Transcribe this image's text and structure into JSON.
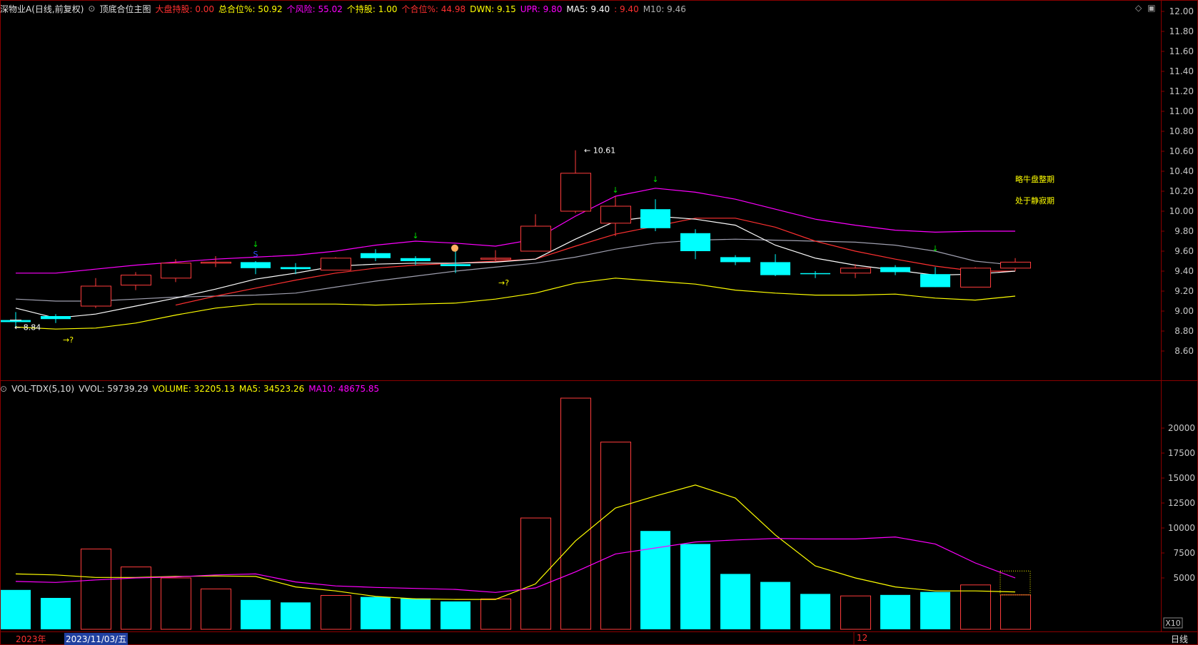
{
  "header": {
    "stock": "深物业A(日线,前复权)",
    "indicator": "顶底合位主图",
    "items": [
      {
        "label": "大盘持股: 0.00",
        "color": "#ff3030"
      },
      {
        "label": "总合位%: 50.92",
        "color": "#ffff00"
      },
      {
        "label": "个风险: 55.02",
        "color": "#ff00ff"
      },
      {
        "label": "个持股: 1.00",
        "color": "#ffff00"
      },
      {
        "label": "个合位%: 44.98",
        "color": "#ff3030"
      },
      {
        "label": "DWN: 9.15",
        "color": "#ffff00"
      },
      {
        "label": "UPR: 9.80",
        "color": "#ff00ff"
      },
      {
        "label": "MA5: 9.40",
        "color": "#ffffff"
      },
      {
        "label": ": 9.40",
        "color": "#ff3030"
      },
      {
        "label": "M10: 9.46",
        "color": "#b0b0b0"
      }
    ]
  },
  "vol_header": {
    "name": "VOL-TDX(5,10)",
    "vvol": "VVOL: 59739.29",
    "volume": "VOLUME: 32205.13",
    "ma5": "MA5: 34523.26",
    "ma10": "MA10: 48675.85"
  },
  "annotations": {
    "high": "10.61",
    "low": "8.84",
    "side1": "略牛盘整期",
    "side2": "处于静寂期",
    "q1": "→?",
    "q2": "→?",
    "s": "S"
  },
  "footer": {
    "year": "2023年",
    "date": "2023/11/03/五",
    "month": "12",
    "period": "日线",
    "x10": "X10"
  },
  "colors": {
    "up": "#ff3c3c",
    "down": "#00ffff",
    "ma_white": "#ffffff",
    "ma_red": "#ff3030",
    "ma_gray": "#a0a0b0",
    "upr": "#ff00ff",
    "dwn": "#ffff00",
    "grid": "#8b0000"
  },
  "chart_data": {
    "type": "candlestick",
    "price_axis": {
      "ticks": [
        "12.00",
        "11.80",
        "11.60",
        "11.40",
        "11.20",
        "11.00",
        "10.80",
        "10.60",
        "10.40",
        "10.20",
        "10.00",
        "9.80",
        "9.60",
        "9.40",
        "9.20",
        "9.00",
        "8.80",
        "8.60"
      ]
    },
    "volume_axis": {
      "ticks": [
        "20000",
        "17500",
        "15000",
        "12500",
        "10000",
        "7500",
        "5000"
      ]
    },
    "candles": [
      {
        "o": 8.91,
        "h": 8.99,
        "l": 8.84,
        "c": 8.89
      },
      {
        "o": 8.95,
        "h": 8.97,
        "l": 8.88,
        "c": 8.92
      },
      {
        "o": 9.05,
        "h": 9.33,
        "l": 9.03,
        "c": 9.25
      },
      {
        "o": 9.26,
        "h": 9.39,
        "l": 9.21,
        "c": 9.36
      },
      {
        "o": 9.33,
        "h": 9.52,
        "l": 9.29,
        "c": 9.48
      },
      {
        "o": 9.49,
        "h": 9.55,
        "l": 9.44,
        "c": 9.49
      },
      {
        "o": 9.49,
        "h": 9.5,
        "l": 9.37,
        "c": 9.43
      },
      {
        "o": 9.44,
        "h": 9.48,
        "l": 9.37,
        "c": 9.42
      },
      {
        "o": 9.41,
        "h": 9.54,
        "l": 9.41,
        "c": 9.53
      },
      {
        "o": 9.58,
        "h": 9.62,
        "l": 9.5,
        "c": 9.53
      },
      {
        "o": 9.53,
        "h": 9.55,
        "l": 9.46,
        "c": 9.5
      },
      {
        "o": 9.47,
        "h": 9.62,
        "l": 9.38,
        "c": 9.45
      },
      {
        "o": 9.53,
        "h": 9.61,
        "l": 9.5,
        "c": 9.53
      },
      {
        "o": 9.6,
        "h": 9.97,
        "l": 9.6,
        "c": 9.85
      },
      {
        "o": 10.0,
        "h": 10.61,
        "l": 9.98,
        "c": 10.38
      },
      {
        "o": 9.88,
        "h": 10.15,
        "l": 9.75,
        "c": 10.05
      },
      {
        "o": 10.02,
        "h": 10.12,
        "l": 9.8,
        "c": 9.83
      },
      {
        "o": 9.78,
        "h": 9.82,
        "l": 9.52,
        "c": 9.6
      },
      {
        "o": 9.54,
        "h": 9.56,
        "l": 9.46,
        "c": 9.49
      },
      {
        "o": 9.49,
        "h": 9.57,
        "l": 9.35,
        "c": 9.36
      },
      {
        "o": 9.38,
        "h": 9.4,
        "l": 9.33,
        "c": 9.37
      },
      {
        "o": 9.38,
        "h": 9.47,
        "l": 9.33,
        "c": 9.43
      },
      {
        "o": 9.44,
        "h": 9.46,
        "l": 9.36,
        "c": 9.39
      },
      {
        "o": 9.37,
        "h": 9.44,
        "l": 9.24,
        "c": 9.24
      },
      {
        "o": 9.24,
        "h": 9.44,
        "l": 9.24,
        "c": 9.43
      },
      {
        "o": 9.43,
        "h": 9.53,
        "l": 9.4,
        "c": 9.49
      }
    ],
    "volume": [
      3800,
      3000,
      7900,
      6100,
      5000,
      3900,
      2800,
      2550,
      3250,
      3100,
      2950,
      2650,
      2900,
      11000,
      23000,
      18600,
      9700,
      8400,
      5400,
      4600,
      3400,
      3200,
      3300,
      3600,
      4300,
      3300
    ],
    "ma_white": [
      9.03,
      8.93,
      8.97,
      9.05,
      9.13,
      9.22,
      9.32,
      9.38,
      9.45,
      9.47,
      9.48,
      9.48,
      9.49,
      9.52,
      9.72,
      9.9,
      9.95,
      9.92,
      9.86,
      9.66,
      9.53,
      9.46,
      9.41,
      9.36,
      9.37,
      9.4
    ],
    "ma_red": [
      null,
      null,
      null,
      null,
      9.06,
      9.15,
      9.23,
      9.31,
      9.38,
      9.43,
      9.46,
      9.48,
      9.5,
      9.52,
      9.65,
      9.77,
      9.85,
      9.93,
      9.93,
      9.84,
      9.7,
      9.6,
      9.52,
      9.45,
      9.4,
      9.4
    ],
    "ma_gray": [
      9.12,
      9.1,
      9.1,
      9.12,
      9.14,
      9.15,
      9.16,
      9.18,
      9.24,
      9.3,
      9.35,
      9.4,
      9.44,
      9.48,
      9.54,
      9.62,
      9.68,
      9.71,
      9.72,
      9.71,
      9.7,
      9.69,
      9.66,
      9.6,
      9.5,
      9.46
    ],
    "upr": [
      9.38,
      9.38,
      9.42,
      9.46,
      9.49,
      9.52,
      9.54,
      9.56,
      9.6,
      9.66,
      9.7,
      9.68,
      9.65,
      9.72,
      9.95,
      10.15,
      10.23,
      10.19,
      10.12,
      10.02,
      9.92,
      9.86,
      9.81,
      9.79,
      9.8,
      9.8
    ],
    "dwn": [
      8.84,
      8.82,
      8.83,
      8.88,
      8.96,
      9.03,
      9.07,
      9.07,
      9.07,
      9.06,
      9.07,
      9.08,
      9.12,
      9.18,
      9.28,
      9.33,
      9.3,
      9.27,
      9.21,
      9.18,
      9.16,
      9.16,
      9.17,
      9.13,
      9.11,
      9.15
    ],
    "vol_ma5": [
      5400,
      5300,
      5050,
      5050,
      5150,
      5200,
      5150,
      4100,
      3700,
      3150,
      2900,
      2850,
      2850,
      4400,
      8700,
      12000,
      13200,
      14300,
      13000,
      9300,
      6200,
      5000,
      4100,
      3700,
      3700,
      3600
    ],
    "vol_ma10": [
      4650,
      4550,
      4800,
      5000,
      5100,
      5300,
      5400,
      4600,
      4200,
      4050,
      3950,
      3850,
      3550,
      4000,
      5600,
      7400,
      8000,
      8600,
      8800,
      8950,
      8900,
      8900,
      9100,
      8400,
      6500,
      5000
    ]
  }
}
